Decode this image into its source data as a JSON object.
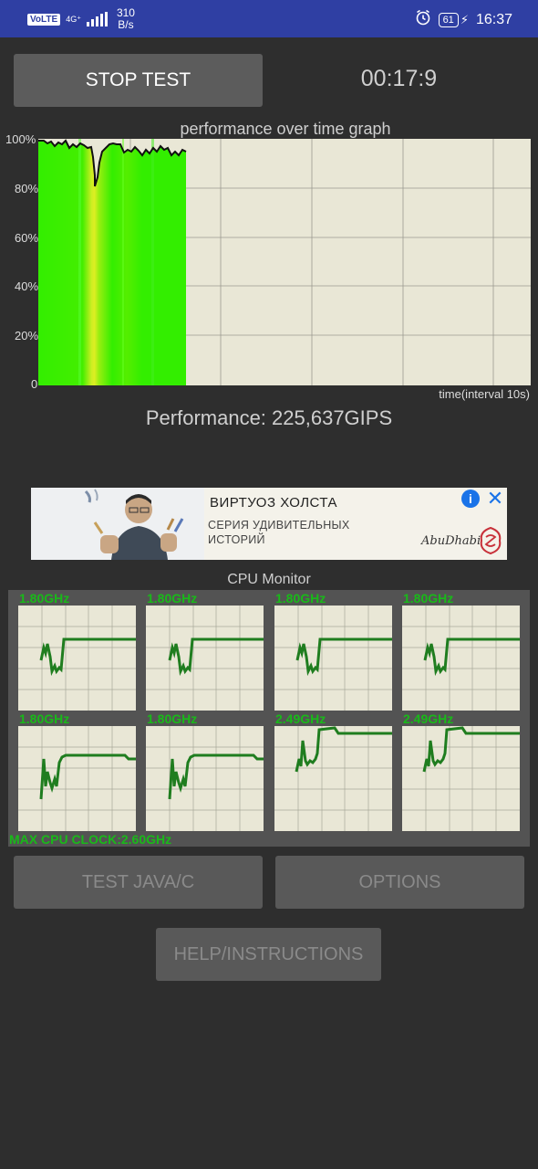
{
  "status_bar": {
    "volte": "VoLTE",
    "network": "4G⁺",
    "speed_value": "310",
    "speed_unit": "B/s",
    "battery": "61",
    "time": "16:37",
    "icons": [
      "alarm-icon",
      "battery-icon",
      "charging-icon",
      "signal-icon"
    ]
  },
  "controls": {
    "stop_label": "STOP TEST",
    "timer": "00:17:9"
  },
  "performance_graph": {
    "title": "performance over time graph",
    "y_ticks": [
      "100%",
      "80%",
      "60%",
      "40%",
      "20%",
      "0"
    ],
    "x_label": "time(interval 10s)",
    "fill_color": "#33ee00",
    "highlight_color": "#ddee22",
    "background": "#e9e7d6"
  },
  "performance_text": "Performance: 225,637GIPS",
  "ad": {
    "title": "ВИРТУОЗ ХОЛСТА",
    "subtitle_line1": "СЕРИЯ УДИВИТЕЛЬНЫХ",
    "subtitle_line2": "ИСТОРИЙ",
    "brand": "AbuDhabi",
    "info_icon": "info-icon",
    "close_icon": "close-icon"
  },
  "cpu_monitor": {
    "title": "CPU Monitor",
    "cores": [
      {
        "freq": "1.80GHz"
      },
      {
        "freq": "1.80GHz"
      },
      {
        "freq": "1.80GHz"
      },
      {
        "freq": "1.80GHz"
      },
      {
        "freq": "1.80GHz"
      },
      {
        "freq": "1.80GHz"
      },
      {
        "freq": "2.49GHz"
      },
      {
        "freq": "2.49GHz"
      }
    ],
    "max_clock": "MAX CPU CLOCK:2.60GHz",
    "line_color": "#1f7d1f"
  },
  "buttons": {
    "test_java": "TEST JAVA/C",
    "options": "OPTIONS",
    "help": "HELP/INSTRUCTIONS"
  }
}
